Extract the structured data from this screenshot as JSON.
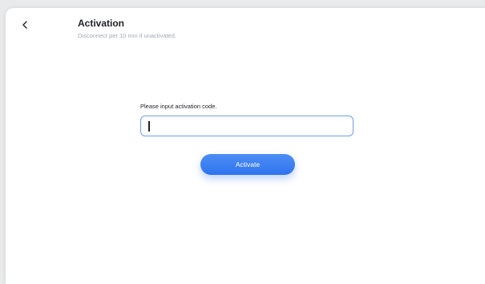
{
  "header": {
    "back_icon": "chevron-left-icon",
    "title": "Activation",
    "subtitle": "Disconnect per 10 min if unactivated."
  },
  "form": {
    "label": "Please input activation code.",
    "input_value": "",
    "input_placeholder": "",
    "submit_label": "Activate"
  },
  "colors": {
    "accent": "#2f74ee",
    "input_border": "#6f9ee6",
    "title_text": "#1f2126",
    "subtitle_text": "#a6a9af"
  }
}
